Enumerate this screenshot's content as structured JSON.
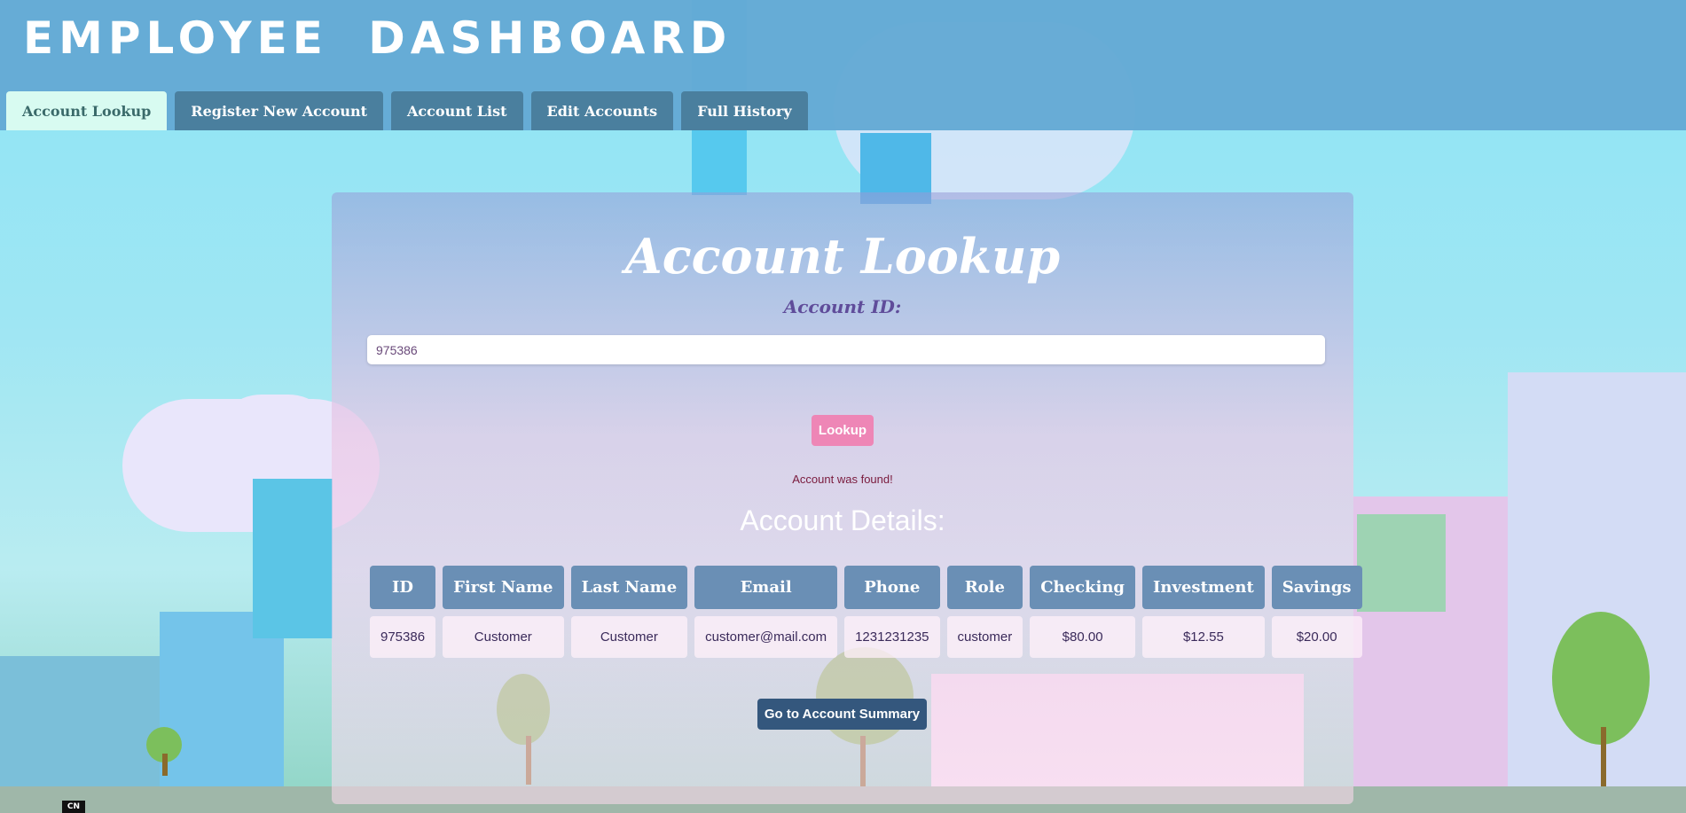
{
  "header": {
    "brand": "EMPLOYEE DASHBOARD",
    "tabs": [
      {
        "label": "Account Lookup",
        "active": true
      },
      {
        "label": "Register New Account",
        "active": false
      },
      {
        "label": "Account List",
        "active": false
      },
      {
        "label": "Edit Accounts",
        "active": false
      },
      {
        "label": "Full History",
        "active": false
      }
    ]
  },
  "lookup": {
    "title": "Account Lookup",
    "field_label": "Account ID:",
    "account_id_value": "975386",
    "button_label": "Lookup",
    "status_message": "Account was found!"
  },
  "details": {
    "title": "Account Details:",
    "columns": [
      "ID",
      "First Name",
      "Last Name",
      "Email",
      "Phone",
      "Role",
      "Checking",
      "Investment",
      "Savings"
    ],
    "row": [
      "975386",
      "Customer",
      "Customer",
      "customer@mail.com",
      "1231231235",
      "customer",
      "$80.00",
      "$12.55",
      "$20.00"
    ],
    "summary_button": "Go to Account Summary"
  },
  "watermark": "CN",
  "colors": {
    "header_bg": "#64aad4",
    "tab_bg": "#4a7f9e",
    "tab_active_bg": "#d8fbf1",
    "lookup_button": "#ee86b6",
    "summary_button": "#34577d",
    "table_header": "#6a8fb5"
  }
}
